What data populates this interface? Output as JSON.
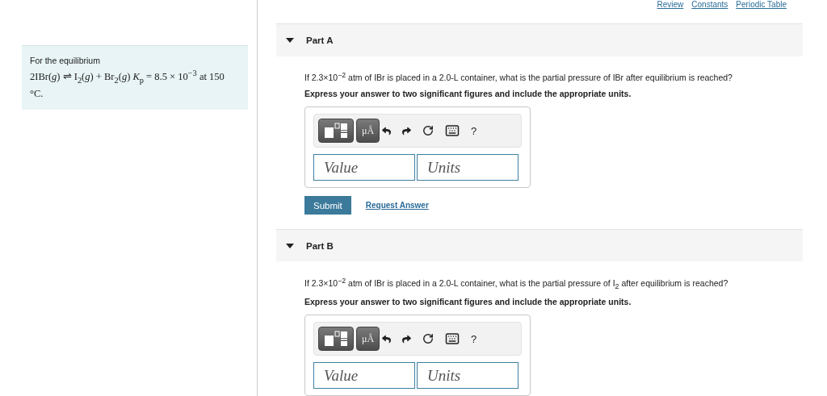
{
  "links": [
    {
      "label": "Review"
    },
    {
      "label": "Constants"
    },
    {
      "label": "Periodic Table"
    }
  ],
  "problem": {
    "intro": "For the equilibrium",
    "equation": "2IBr(*g*) ⇌ I$_{2}$(*g*) + Br$_{2}$(*g*) *K*$_{p}$ = 8.5 × 10$^{−3}$ at 150 °C."
  },
  "parts": [
    {
      "title": "Part A",
      "expanded": true,
      "question": "If 2.3×10$^{−2}$ atm of IBr is placed in a 2.0-L container, what is the partial pressure of IBr after equilibrium is reached?",
      "instruction": "Express your answer to two significant figures and include the appropriate units.",
      "units_button": "μÅ",
      "help": "?",
      "value_placeholder": "Value",
      "units_placeholder": "Units",
      "submit": "Submit",
      "request": "Request Answer"
    },
    {
      "title": "Part B",
      "expanded": true,
      "question": "If 2.3×10$^{−2}$ atm of IBr is placed in a 2.0-L container, what is the partial pressure of I$_{2}$ after equilibrium is reached?",
      "instruction": "Express your answer to two significant figures and include the appropriate units.",
      "units_button": "μÅ",
      "help": "?",
      "value_placeholder": "Value",
      "units_placeholder": "Units"
    }
  ]
}
